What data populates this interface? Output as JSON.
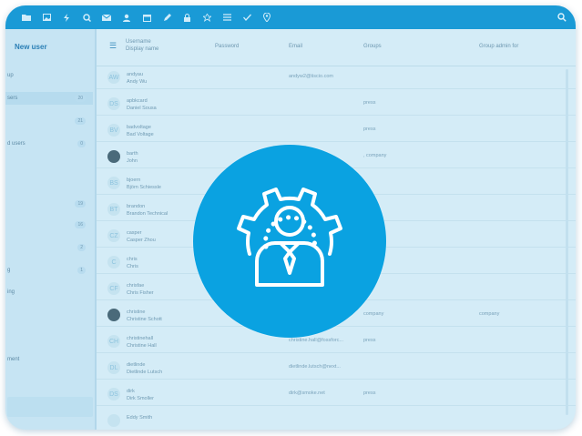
{
  "topbar": {
    "icons": [
      "folder-icon",
      "image-icon",
      "bolt-icon",
      "search-circle-icon",
      "mail-icon",
      "contacts-icon",
      "calendar-icon",
      "pencil-icon",
      "lock-icon",
      "star-icon",
      "list-icon",
      "check-icon",
      "location-icon"
    ],
    "search_icon": "search-icon"
  },
  "sidebar": {
    "new_user_label": "New user",
    "items": [
      {
        "label": "up",
        "count": ""
      },
      {
        "label": "sers",
        "count": "20"
      },
      {
        "label": "",
        "count": "21"
      },
      {
        "label": "d users",
        "count": "0"
      },
      {
        "label": "",
        "count": "19"
      },
      {
        "label": "",
        "count": "16"
      },
      {
        "label": "",
        "count": "2"
      },
      {
        "label": "g",
        "count": "1"
      },
      {
        "label": "ing",
        "count": ""
      },
      {
        "label": "ment",
        "count": ""
      }
    ]
  },
  "table": {
    "header": {
      "username": "Username",
      "display_name": "Display name",
      "password": "Password",
      "email": "Email",
      "groups": "Groups",
      "group_admin": "Group admin for"
    },
    "rows": [
      {
        "initials": "AW",
        "username": "andyau",
        "display": "Andy Wu",
        "email": "andyw2@tiscio.com",
        "groups": "",
        "admin": "",
        "photo": false
      },
      {
        "initials": "DS",
        "username": "apbkcard",
        "display": "Daniel Sousa",
        "email": "",
        "groups": "press",
        "admin": "",
        "photo": false
      },
      {
        "initials": "BV",
        "username": "badvoltage",
        "display": "Bad Voltage",
        "email": "",
        "groups": "press",
        "admin": "",
        "photo": false
      },
      {
        "initials": "",
        "username": "barth",
        "display": "John",
        "email": "",
        "groups": ", company",
        "admin": "",
        "photo": true
      },
      {
        "initials": "BS",
        "username": "bjoern",
        "display": "Björn Schiessle",
        "email": "",
        "groups": "",
        "admin": "",
        "photo": false
      },
      {
        "initials": "BT",
        "username": "brandon",
        "display": "Brandon Technical",
        "email": "",
        "groups": "",
        "admin": "",
        "photo": false
      },
      {
        "initials": "CZ",
        "username": "casper",
        "display": "Casper Zhou",
        "email": "",
        "groups": "eting",
        "admin": "",
        "photo": false
      },
      {
        "initials": "C",
        "username": "chris",
        "display": "Chris",
        "email": "",
        "groups": "any",
        "admin": "",
        "photo": false
      },
      {
        "initials": "CF",
        "username": "chrisfae",
        "display": "Chris Fisher",
        "email": "",
        "groups": "",
        "admin": "",
        "photo": false
      },
      {
        "initials": "",
        "username": "christine",
        "display": "Christine Schott",
        "email": "",
        "groups": "company",
        "admin": "company",
        "photo": true
      },
      {
        "initials": "CH",
        "username": "christinehall",
        "display": "Christine Hall",
        "email": "christine.hall@fossforc...",
        "groups": "press",
        "admin": "",
        "photo": false
      },
      {
        "initials": "DL",
        "username": "dietlinde",
        "display": "Dietlinde Lutsch",
        "email": "dietlinde.lutsch@next...",
        "groups": "",
        "admin": "",
        "photo": false
      },
      {
        "initials": "DS",
        "username": "dirk",
        "display": "Dirk Smoller",
        "email": "dirk@smoke.net",
        "groups": "press",
        "admin": "",
        "photo": false
      },
      {
        "initials": "",
        "username": "Eddy Smith",
        "display": "",
        "email": "",
        "groups": "",
        "admin": "",
        "photo": false
      }
    ]
  },
  "badge_icon": "gear-person-icon",
  "colors": {
    "topbar": "#1a9ad6",
    "badge": "#0aa2e1",
    "background": "#d4ecf7"
  }
}
